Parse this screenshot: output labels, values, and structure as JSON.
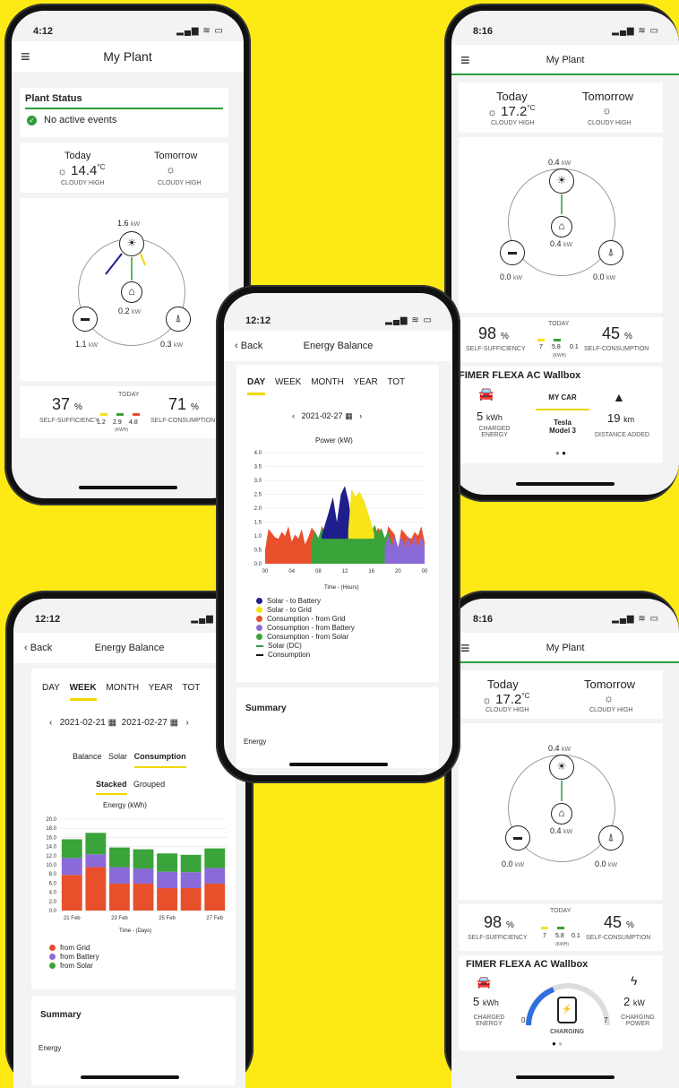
{
  "p1": {
    "time": "4:12",
    "title": "My Plant",
    "status_title": "Plant Status",
    "status_text": "No active events",
    "today": "Today",
    "tomorrow": "Tomorrow",
    "temp": "14.4",
    "unit": "°C",
    "cond_today": "CLOUDY HIGH",
    "cond_tomorrow": "CLOUDY HIGH",
    "pv": "1.6",
    "kw": "kW",
    "home": "0.2",
    "battery": "1.1",
    "grid": "0.3",
    "self_suff": "37",
    "pct": "%",
    "self_suff_label": "SELF-SUFFICIENCY",
    "self_cons": "71",
    "self_cons_label": "SELF-CONSUMPTION",
    "today_label": "TODAY",
    "bar1": "1.2",
    "bar2": "2.9",
    "bar3": "4.8",
    "kwh_label": "(kWh)"
  },
  "p2": {
    "time": "8:16",
    "title": "My Plant",
    "today": "Today",
    "tomorrow": "Tomorrow",
    "temp": "17.2",
    "unit": "°C",
    "cond_today": "CLOUDY HIGH",
    "cond_tomorrow": "CLOUDY HIGH",
    "pv": "0.4",
    "kw": "kW",
    "home": "0.4",
    "battery": "0.0",
    "grid": "0.0",
    "self_suff": "98",
    "pct": "%",
    "self_suff_label": "SELF-SUFFICIENCY",
    "self_cons": "45",
    "self_cons_label": "SELF-CONSUMPTION",
    "today_label": "TODAY",
    "bar1": "7",
    "bar2": "5.8",
    "bar3": "0.1",
    "kwh_label": "(kWh)",
    "wallbox": "FIMER FLEXA AC Wallbox",
    "my_car": "MY CAR",
    "car_model": "Tesla Model 3",
    "energy": "5",
    "energy_unit": "kWh",
    "charged_label": "CHARGED ENERGY",
    "distance": "19",
    "distance_unit": "km",
    "distance_label": "DISTANCE ADDED"
  },
  "p3": {
    "time": "12:12",
    "back": "Back",
    "title": "Energy Balance",
    "tabs": [
      "DAY",
      "WEEK",
      "MONTH",
      "YEAR",
      "TOT"
    ],
    "date": "2021-02-27",
    "chart_title": "Power (kW)",
    "xlabel": "Time - (Hours)",
    "summary": "Summary",
    "energy": "Energy",
    "legend": [
      "Solar - to Battery",
      "Solar - to Grid",
      "Consumption - from Grid",
      "Consumption - from Battery",
      "Consumption - from Solar",
      "Solar (DC)",
      "Consumption"
    ]
  },
  "p4": {
    "time": "12:12",
    "back": "Back",
    "title": "Energy Balance",
    "tabs": [
      "DAY",
      "WEEK",
      "MONTH",
      "YEAR",
      "TOT"
    ],
    "date_from": "2021-02-21",
    "date_to": "2021-02-27",
    "subtabs": [
      "Balance",
      "Solar",
      "Consumption"
    ],
    "modes": [
      "Stacked",
      "Grouped"
    ],
    "chart_title": "Energy (kWh)",
    "xlabel": "Time - (Days)",
    "legend": [
      "from Grid",
      "from Battery",
      "from Solar"
    ],
    "summary": "Summary",
    "energy": "Energy"
  },
  "p5": {
    "time": "8:16",
    "title": "My Plant",
    "today": "Today",
    "tomorrow": "Tomorrow",
    "temp": "17.2",
    "unit": "°C",
    "cond_today": "CLOUDY HIGH",
    "cond_tomorrow": "CLOUDY HIGH",
    "pv": "0.4",
    "kw": "kW",
    "home": "0.4",
    "battery": "0.0",
    "grid": "0.0",
    "self_suff": "98",
    "pct": "%",
    "self_suff_label": "SELF-SUFFICIENCY",
    "self_cons": "45",
    "self_cons_label": "SELF-CONSUMPTION",
    "today_label": "TODAY",
    "bar1": "7",
    "bar2": "5.8",
    "bar3": "0.1",
    "kwh_label": "(kWh)",
    "wallbox": "FIMER FLEXA AC Wallbox",
    "energy": "5",
    "energy_unit": "kWh",
    "charged_label": "CHARGED ENERGY",
    "gauge_min": "0",
    "gauge_max": "7",
    "charging": "CHARGING",
    "power": "2",
    "power_unit": "kW",
    "power_label": "CHARGING POWER"
  },
  "chart_data": [
    {
      "type": "area",
      "title": "Power (kW)",
      "xlabel": "Time - (Hours)",
      "ylim": [
        0,
        4.0
      ],
      "yticks": [
        "4.0",
        "3.5",
        "3.0",
        "2.5",
        "2.0",
        "1.5",
        "1.0",
        "0.5",
        "0.0"
      ],
      "xticks": [
        "00",
        "04",
        "08",
        "12",
        "16",
        "20",
        "00"
      ],
      "series": [
        {
          "name": "Consumption - from Grid",
          "color": "#e8502c"
        },
        {
          "name": "Consumption - from Solar",
          "color": "#3aa33a"
        },
        {
          "name": "Solar - to Battery",
          "color": "#1e1e8c"
        },
        {
          "name": "Solar - to Grid",
          "color": "#f7e419"
        },
        {
          "name": "Consumption - from Battery",
          "color": "#8a6ad8"
        }
      ]
    },
    {
      "type": "bar",
      "title": "Energy (kWh)",
      "xlabel": "Time - (Days)",
      "ylim": [
        0,
        20
      ],
      "yticks": [
        "20.0",
        "18.0",
        "16.0",
        "14.0",
        "12.0",
        "10.0",
        "8.0",
        "6.0",
        "4.0",
        "2.0",
        "0.0"
      ],
      "categories": [
        "21 Feb",
        "22 Feb",
        "23 Feb",
        "24 Feb",
        "25 Feb",
        "26 Feb",
        "27 Feb"
      ],
      "xticks": [
        "21 Feb",
        "23 Feb",
        "25 Feb",
        "27 Feb"
      ],
      "series": [
        {
          "name": "from Grid",
          "color": "#e8502c",
          "values": [
            7.8,
            9.5,
            5.9,
            5.9,
            4.9,
            4.9,
            5.9
          ]
        },
        {
          "name": "from Battery",
          "color": "#8a6ad8",
          "values": [
            3.7,
            2.8,
            3.6,
            3.3,
            3.6,
            3.5,
            3.4
          ]
        },
        {
          "name": "from Solar",
          "color": "#3aa33a",
          "values": [
            4.1,
            4.7,
            4.3,
            4.2,
            4.0,
            3.8,
            4.3
          ]
        }
      ]
    }
  ]
}
